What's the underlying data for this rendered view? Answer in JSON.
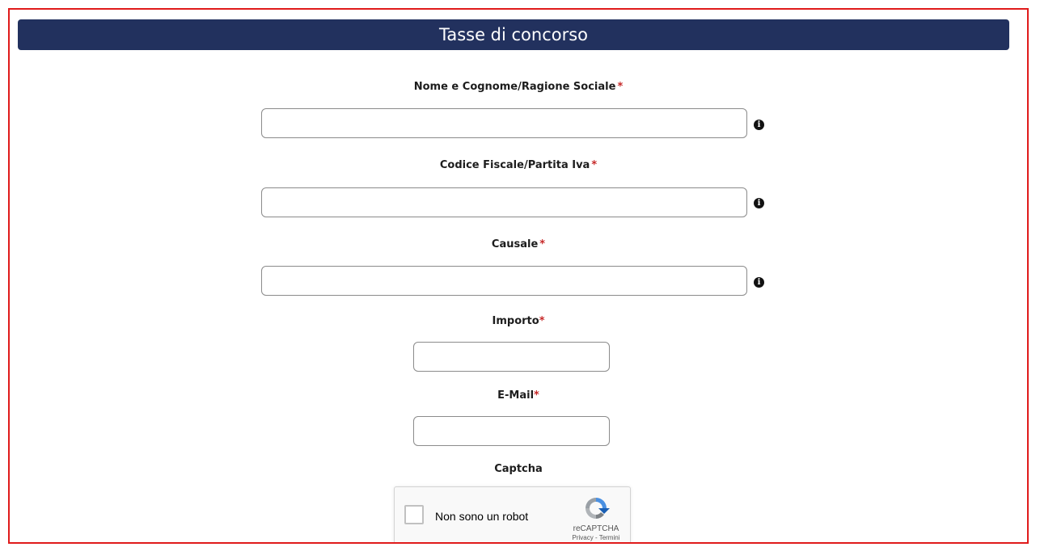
{
  "form": {
    "title": "Tasse di concorso",
    "fields": [
      {
        "label": "Nome e Cognome/Ragione Sociale",
        "required_mark": "*",
        "value": "",
        "placeholder": ""
      },
      {
        "label": "Codice Fiscale/Partita Iva",
        "required_mark": "*",
        "value": "",
        "placeholder": ""
      },
      {
        "label": "Causale",
        "required_mark": "*",
        "value": "",
        "placeholder": ""
      },
      {
        "label": "Importo",
        "required_mark": "*",
        "value": "",
        "placeholder": ""
      },
      {
        "label": "E-Mail",
        "required_mark": "*",
        "value": "",
        "placeholder": ""
      }
    ],
    "captcha": {
      "label": "Captcha",
      "checkbox_text": "Non sono un robot",
      "brand": "reCAPTCHA",
      "links": "Privacy - Termini"
    }
  },
  "icons": {
    "info": "info-circle-icon",
    "recaptcha": "recaptcha-logo-icon"
  },
  "colors": {
    "header_bg": "#22315e",
    "border_highlight": "#e01b1b",
    "required": "#c62828"
  }
}
